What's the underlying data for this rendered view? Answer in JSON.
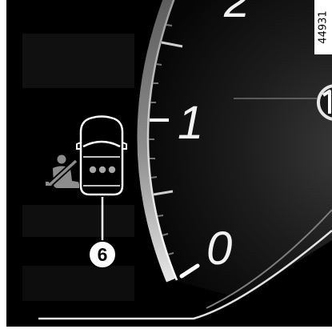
{
  "figure": {
    "reference_number": "44931",
    "background_color": "#000000",
    "frame_color": "#ffffff"
  },
  "gauge": {
    "scale_labels": [
      "2",
      "1",
      "0"
    ],
    "label_color": "#f2f2f2"
  },
  "warning_lights": {
    "seatbelt_icon": "seatbelt-warning-icon",
    "seatbelt_color": "#8c8c8c",
    "car_icon": "car-top-view-icon",
    "car_outline_color": "#ffffff",
    "rear_indicator_icon": "rear-seatbelt-indicator-dots",
    "rear_indicator_color": "#a6a6a6"
  },
  "callout": {
    "label": "6"
  }
}
